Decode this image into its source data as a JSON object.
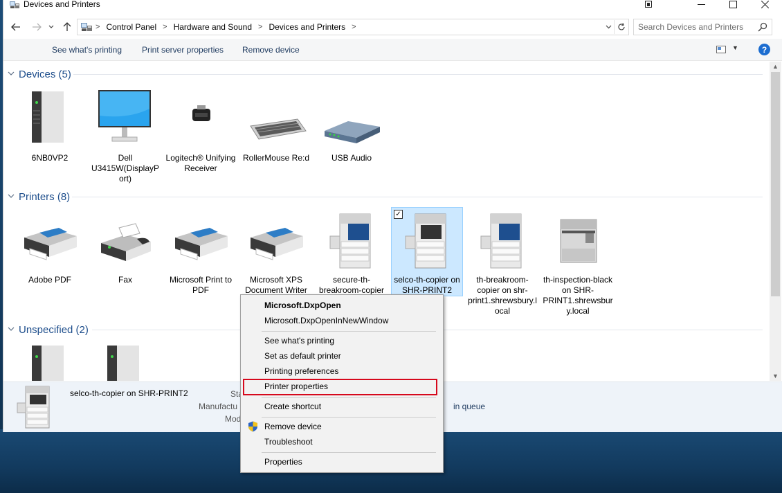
{
  "window": {
    "title": "Devices and Printers",
    "icon": "devices-printers-icon"
  },
  "address": {
    "breadcrumbs": [
      "Control Panel",
      "Hardware and Sound",
      "Devices and Printers"
    ],
    "search_placeholder": "Search Devices and Printers"
  },
  "commands": {
    "see_printing": "See what's printing",
    "print_server": "Print server properties",
    "remove_device": "Remove device",
    "help": "?"
  },
  "groups": {
    "devices": {
      "title": "Devices (5)"
    },
    "printers": {
      "title": "Printers (8)"
    },
    "unspecified": {
      "title": "Unspecified (2)"
    }
  },
  "devices": [
    {
      "label": "6NB0VP2",
      "icon": "tower-pc-icon"
    },
    {
      "label": "Dell U3415W(DisplayPort)",
      "icon": "monitor-icon"
    },
    {
      "label": "Logitech® Unifying Receiver",
      "icon": "usb-receiver-icon"
    },
    {
      "label": "RollerMouse Re:d",
      "icon": "keyboard-icon"
    },
    {
      "label": "USB Audio",
      "icon": "audio-device-icon"
    }
  ],
  "printers": [
    {
      "label": "Adobe PDF",
      "icon": "printer-icon"
    },
    {
      "label": "Fax",
      "icon": "fax-icon"
    },
    {
      "label": "Microsoft Print to PDF",
      "icon": "printer-icon"
    },
    {
      "label": "Microsoft XPS Document Writer",
      "icon": "printer-icon"
    },
    {
      "label": "secure-th-breakroom-copier on",
      "icon": "copier-icon"
    },
    {
      "label": "selco-th-copier on SHR-PRINT2",
      "icon": "copier-icon",
      "selected": true
    },
    {
      "label": "th-breakroom-copier on shr-print1.shrewsbury.local",
      "icon": "copier-icon"
    },
    {
      "label": "th-inspection-black on SHR-PRINT1.shrewsbury.local",
      "icon": "laser-printer-icon"
    }
  ],
  "details": {
    "name": "selco-th-copier on SHR-PRINT2",
    "status_label": "Sta",
    "manufacturer_label": "Manufactu",
    "model_label": "Mod",
    "queue_text": "in queue"
  },
  "context_menu": {
    "items": [
      {
        "label": "Microsoft.DxpOpen",
        "bold": true
      },
      {
        "label": "Microsoft.DxpOpenInNewWindow"
      },
      {
        "label": "See what's printing"
      },
      {
        "label": "Set as default printer"
      },
      {
        "label": "Printing preferences"
      },
      {
        "label": "Printer properties",
        "highlighted": true
      },
      {
        "label": "Create shortcut"
      },
      {
        "label": "Remove device",
        "icon": "shield-icon"
      },
      {
        "label": "Troubleshoot"
      },
      {
        "label": "Properties"
      }
    ]
  },
  "colors": {
    "accent": "#1e4e8c",
    "selection": "#cce8ff",
    "highlight_border": "#d6081c",
    "desktop": "#163e63"
  }
}
